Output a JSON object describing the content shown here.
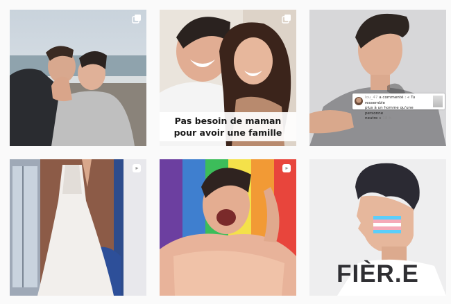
{
  "grid": {
    "posts": [
      {
        "kind": "carousel",
        "badge_icon": "carousel-icon"
      },
      {
        "kind": "carousel",
        "badge_icon": "carousel-icon",
        "caption_line1": "Pas besoin de maman",
        "caption_line2": "pour avoir une famille"
      },
      {
        "kind": "image",
        "comment": {
          "username": "lou_47",
          "text": "a commenté : « Tu ressemble",
          "text2": "plus à un homme qu'une personne",
          "text3": "neutre »",
          "time": "18 h"
        }
      },
      {
        "kind": "reel",
        "badge_icon": "reel-icon"
      },
      {
        "kind": "reel",
        "badge_icon": "reel-icon"
      },
      {
        "kind": "image",
        "headline": "FIÈR.E"
      }
    ]
  },
  "colors": {
    "background": "#fafafa",
    "text_dark": "#2f2f33",
    "trans_blue": "#5bcefa",
    "trans_pink": "#f5a9b8"
  }
}
